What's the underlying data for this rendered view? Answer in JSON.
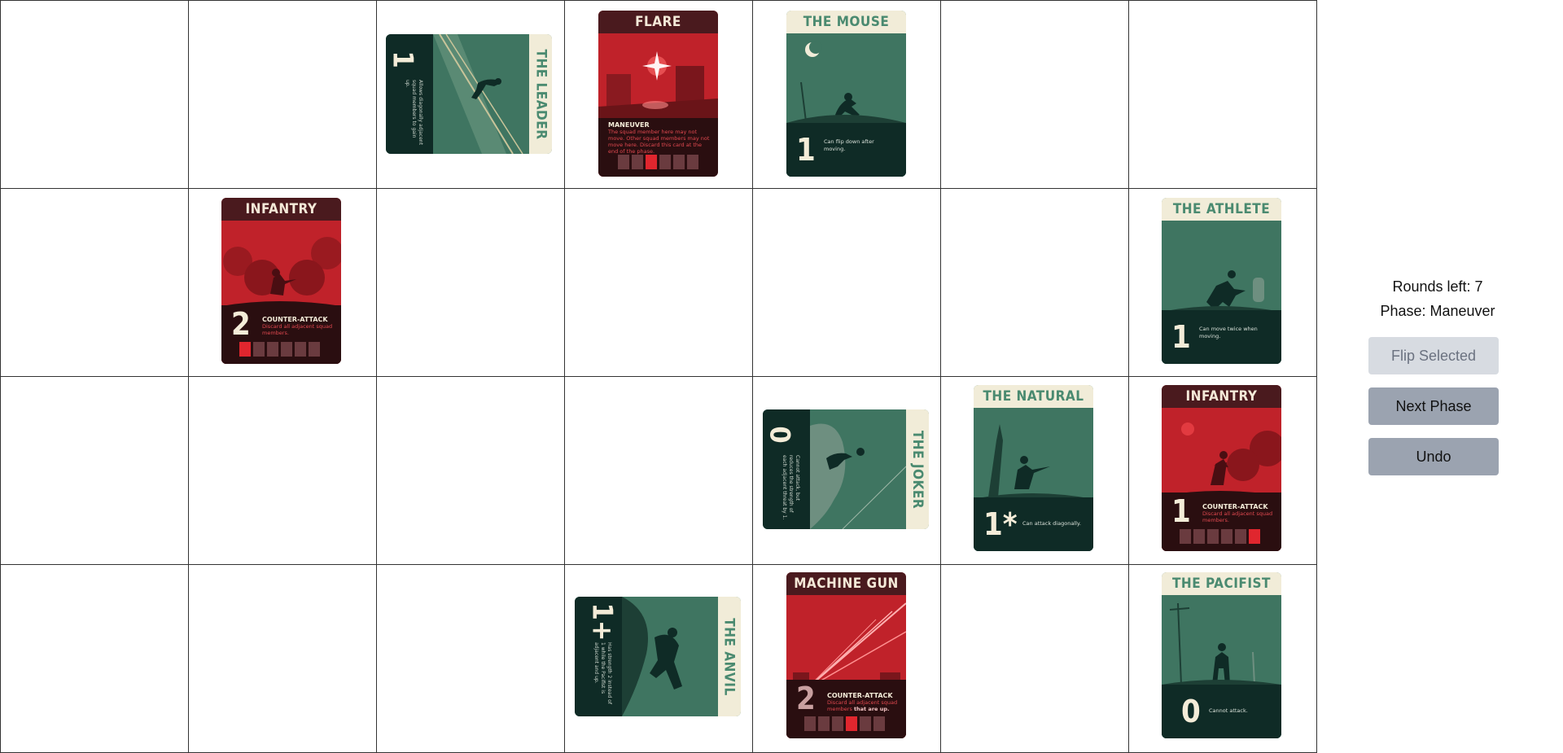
{
  "panel": {
    "rounds_left": "Rounds left: 7",
    "phase": "Phase: Maneuver",
    "flip_selected": "Flip Selected",
    "next_phase": "Next Phase",
    "undo": "Undo"
  },
  "cards": {
    "leader": {
      "title": "THE LEADER",
      "value": "1",
      "text": "Allows diagonally adjacent squad members to gain up."
    },
    "flare": {
      "title": "FLARE",
      "ability": "MANEUVER",
      "text": "The squad member here may not move. Other squad members may not move here. Discard this card at the end of the phase.",
      "level": 3
    },
    "mouse": {
      "title": "THE MOUSE",
      "value": "1",
      "text": "Can flip down after moving."
    },
    "infantry_a": {
      "title": "INFANTRY",
      "value": "2",
      "ability": "COUNTER-ATTACK",
      "text": "Discard all adjacent squad members.",
      "level": 1
    },
    "athlete": {
      "title": "THE ATHLETE",
      "value": "1",
      "text": "Can move twice when moving."
    },
    "joker": {
      "title": "THE JOKER",
      "value": "0",
      "text": "Cannot attack, but reduces the strength of each adjacent threat by 1."
    },
    "natural": {
      "title": "THE NATURAL",
      "value": "1*",
      "text": "Can attack diagonally."
    },
    "infantry_b": {
      "title": "INFANTRY",
      "value": "1",
      "ability": "COUNTER-ATTACK",
      "text": "Discard all adjacent squad members.",
      "level": 6
    },
    "anvil": {
      "title": "THE ANVIL",
      "value": "1+",
      "text": "Has strength 2 instead of 1 while the Pacifist is adjacent and up."
    },
    "machine_gun": {
      "title": "MACHINE GUN",
      "value": "2",
      "ability": "COUNTER-ATTACK",
      "text": "Discard all adjacent squad members",
      "text_b": "that are up.",
      "level": 4
    },
    "pacifist": {
      "title": "THE PACIFIST",
      "value": "0",
      "text": "Cannot attack."
    }
  },
  "colors": {
    "green": "#3f7561",
    "red": "#c0222a",
    "cream": "#f1ecd8",
    "dark": "#0f2b26"
  }
}
